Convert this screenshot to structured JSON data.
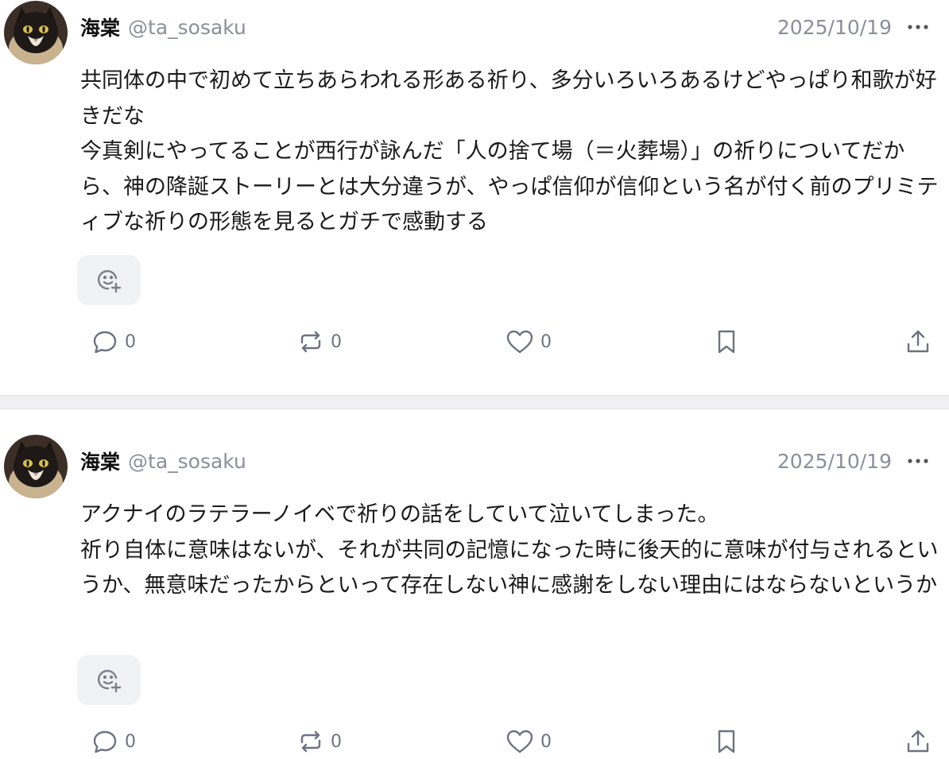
{
  "posts": [
    {
      "author": {
        "display_name": "海棠",
        "handle": "@ta_sosaku"
      },
      "date": "2025/10/19",
      "text": "共同体の中で初めて立ちあらわれる形ある祈り、多分いろいろあるけどやっぱり和歌が好きだな\n今真剣にやってることが西行が詠んだ「人の捨て場（＝火葬場）」の祈りについてだから、神の降誕ストーリーとは大分違うが、やっぱ信仰が信仰という名が付く前のプリミティブな祈りの形態を見るとガチで感動する",
      "counts": {
        "replies": "0",
        "reposts": "0",
        "likes": "0"
      }
    },
    {
      "author": {
        "display_name": "海棠",
        "handle": "@ta_sosaku"
      },
      "date": "2025/10/19",
      "text": "アクナイのラテラーノイベで祈りの話をしていて泣いてしまった。\n祈り自体に意味はないが、それが共同の記憶になった時に後天的に意味が付与されるというか、無意味だったからといって存在しない神に感謝をしない理由にはならないというか",
      "counts": {
        "replies": "0",
        "reposts": "0",
        "likes": "0"
      }
    }
  ],
  "icons": {
    "more": "more-horizontal-icon",
    "reaction": "add-reaction-icon",
    "reply": "speech-bubble-icon",
    "repost": "repost-arrows-icon",
    "like": "heart-icon",
    "bookmark": "bookmark-icon",
    "share": "share-upload-icon"
  },
  "colors": {
    "muted": "#8b8f9c",
    "separator": "#f0f0f2",
    "reaction_bg": "#f1f2f4"
  }
}
